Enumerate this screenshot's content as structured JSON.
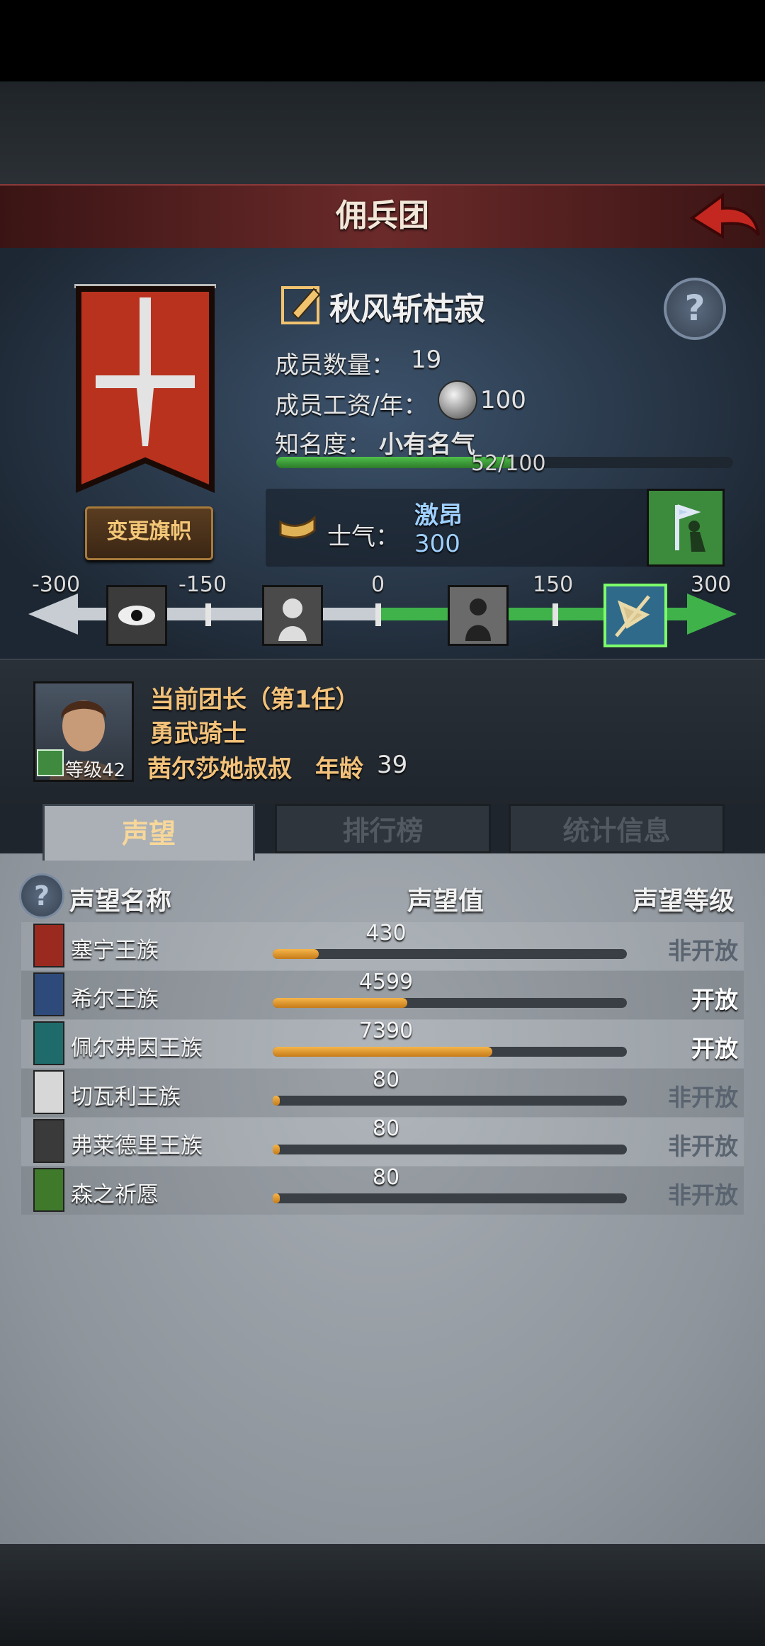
{
  "header": {
    "title": "佣兵团"
  },
  "guild": {
    "name": "秋风斩枯寂",
    "change_flag_label": "变更旗帜",
    "members_label": "成员数量：",
    "members_value": "19",
    "salary_label": "成员工资/年：",
    "salary_value": "100",
    "fame_label": "知名度：",
    "fame_value": "小有名气",
    "fame_progress_text": "52/100",
    "fame_progress": 0.52,
    "morale_label": "士气：",
    "morale_word": "激昂",
    "morale_value": "300"
  },
  "morale_scale": {
    "ticks": [
      "-300",
      "-150",
      "0",
      "150",
      "300"
    ],
    "icons": [
      "eye-icon",
      "despair-icon",
      "calm-icon",
      "charge-icon"
    ],
    "active_icon_index": 3
  },
  "leader": {
    "title": "当前团长（第1任）",
    "class": "勇武骑士",
    "name": "茜尔莎她叔叔",
    "age_label": "年龄",
    "age": "39",
    "level_text": "等级42"
  },
  "tabs": [
    {
      "label": "声望",
      "active": true
    },
    {
      "label": "排行榜",
      "active": false
    },
    {
      "label": "统计信息",
      "active": false
    }
  ],
  "reputation": {
    "col_name": "声望名称",
    "col_value": "声望值",
    "col_level": "声望等级",
    "rows": [
      {
        "name": "塞宁王族",
        "value": "430",
        "progress": 0.13,
        "status": "非开放",
        "open": false,
        "color": "#9a2a1f"
      },
      {
        "name": "希尔王族",
        "value": "4599",
        "progress": 0.38,
        "status": "开放",
        "open": true,
        "color": "#2d4a7a"
      },
      {
        "name": "佩尔弗因王族",
        "value": "7390",
        "progress": 0.62,
        "status": "开放",
        "open": true,
        "color": "#1f6b6b"
      },
      {
        "name": "切瓦利王族",
        "value": "80",
        "progress": 0.02,
        "status": "非开放",
        "open": false,
        "color": "#d7d7d7"
      },
      {
        "name": "弗莱德里王族",
        "value": "80",
        "progress": 0.02,
        "status": "非开放",
        "open": false,
        "color": "#3a3a3a"
      },
      {
        "name": "森之祈愿",
        "value": "80",
        "progress": 0.02,
        "status": "非开放",
        "open": false,
        "color": "#3f7a2a"
      }
    ]
  },
  "colors": {
    "accent_gold": "#f3c27a",
    "open": "#ffffff",
    "closed": "#5a6470"
  }
}
